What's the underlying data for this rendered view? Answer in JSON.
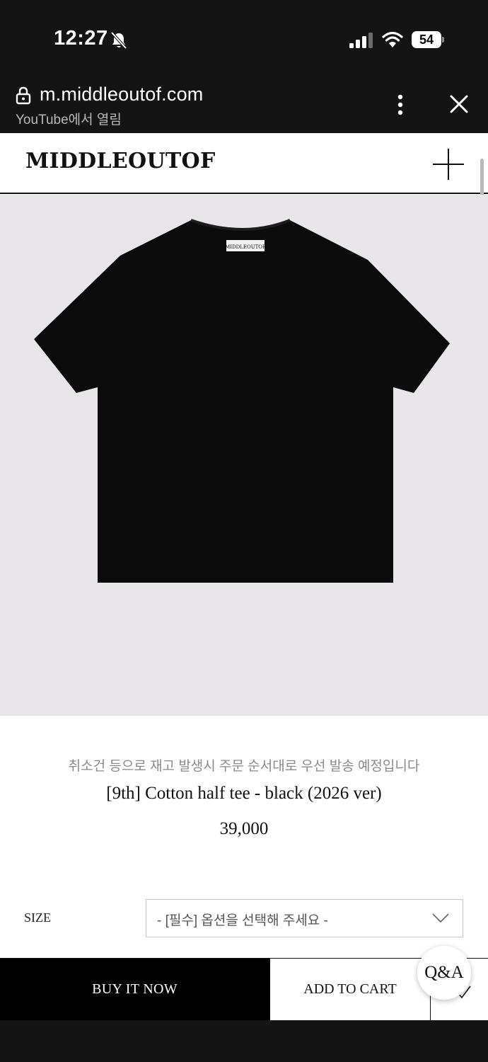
{
  "status_bar": {
    "time": "12:27",
    "battery": "54"
  },
  "browser": {
    "url": "m.middleoutof.com",
    "opened_from": "YouTube에서 열림"
  },
  "site": {
    "logo": "MIDDLEOUTOF"
  },
  "product": {
    "tag_label": "MIDDLEOUTOF",
    "notice": "취소건 등으로 재고 발생시 주문 순서대로 우선 발송 예정입니다",
    "name": "[9th] Cotton half tee - black (2026 ver)",
    "price": "39,000"
  },
  "options": {
    "size_label": "SIZE",
    "size_placeholder": "- [필수] 옵션을 선택해 주세요 -"
  },
  "actions": {
    "buy_now": "BUY IT NOW",
    "add_to_cart": "ADD TO CART",
    "qa": "Q&A"
  },
  "colors": {
    "image_background": "#e8e6e9",
    "shirt": "#0b0b0b",
    "buy_button": "#000000"
  }
}
